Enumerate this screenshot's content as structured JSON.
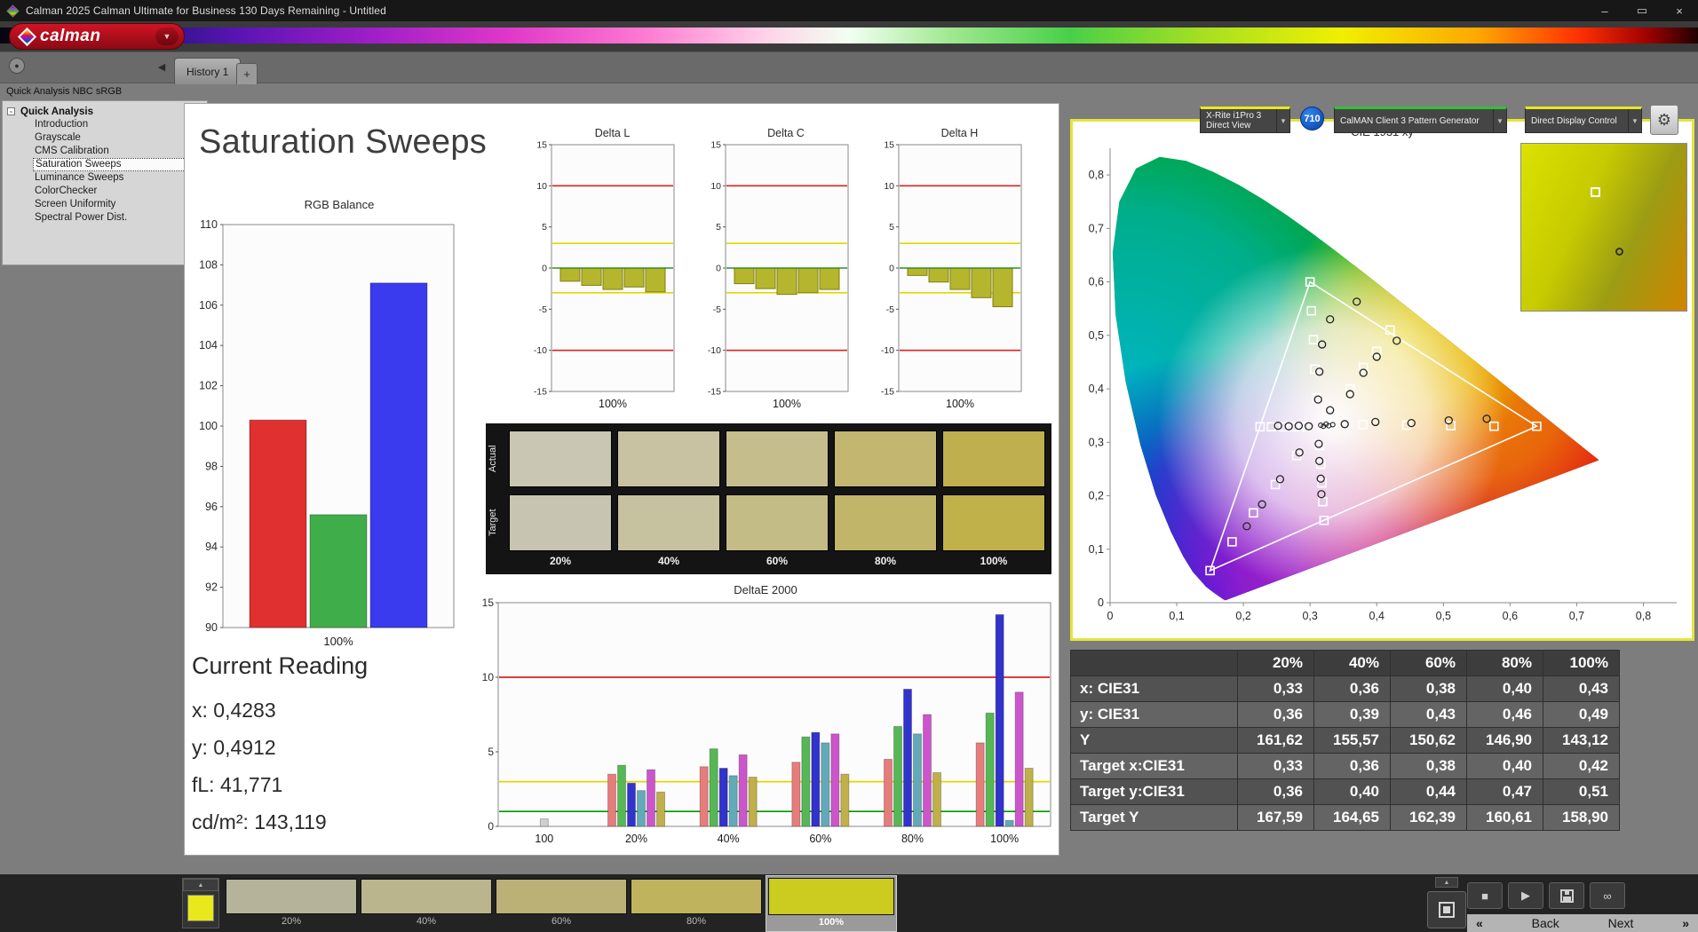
{
  "window": {
    "title": "Calman 2025 Calman Ultimate for Business 130 Days Remaining  - Untitled",
    "controls": {
      "minimize": "–",
      "maximize": "▭",
      "close": "×"
    }
  },
  "logo": {
    "text": "calman"
  },
  "tabs": {
    "history": "History 1",
    "add": "+"
  },
  "device_bar": {
    "meter": {
      "line1": "X-Rite i1Pro 3",
      "line2": "Direct View",
      "accent": "#e8e820"
    },
    "badge": "710",
    "pattern_generator": {
      "label": "CalMAN Client 3 Pattern Generator",
      "accent": "#35c035"
    },
    "display_control": {
      "label": "Direct Display Control",
      "accent": "#e8e820"
    }
  },
  "sidebar": {
    "header": "Quick Analysis NBC sRGB",
    "root": "Quick Analysis",
    "items": [
      {
        "label": "Introduction",
        "selected": false
      },
      {
        "label": "Grayscale",
        "selected": false
      },
      {
        "label": "CMS Calibration",
        "selected": false
      },
      {
        "label": "Saturation Sweeps",
        "selected": true
      },
      {
        "label": "Luminance Sweeps",
        "selected": false
      },
      {
        "label": "ColorChecker",
        "selected": false
      },
      {
        "label": "Screen Uniformity",
        "selected": false
      },
      {
        "label": "Spectral Power Dist.",
        "selected": false
      }
    ]
  },
  "page": {
    "title": "Saturation Sweeps"
  },
  "current_reading": {
    "heading": "Current Reading",
    "lines": [
      "x: 0,4283",
      "y: 0,4912",
      "fL: 41,771",
      "cd/m²: 143,119"
    ]
  },
  "charts": {
    "rgb_balance": {
      "type": "bar",
      "title": "RGB Balance",
      "ymin": 90,
      "ymax": 110,
      "ystep": 2,
      "xlabel": "100%",
      "bars": [
        {
          "name": "red",
          "color": "#e03030",
          "value": 100.3
        },
        {
          "name": "green",
          "color": "#3fae4a",
          "value": 95.6
        },
        {
          "name": "blue",
          "color": "#3a3aee",
          "value": 107.1
        }
      ]
    },
    "delta_common": {
      "ymin": -15,
      "ymax": 15,
      "ystep": 5,
      "bar_color": "#b6b62e",
      "bar_edge": "#80800e",
      "ref_red": 10,
      "ref_yellow": 3,
      "ref_green": 0
    },
    "delta_l": {
      "type": "bar",
      "title": "Delta L",
      "xlabel": "100%",
      "values": [
        -1.6,
        -2.1,
        -2.6,
        -2.3,
        -2.9
      ]
    },
    "delta_c": {
      "type": "bar",
      "title": "Delta C",
      "xlabel": "100%",
      "values": [
        -1.9,
        -2.5,
        -3.2,
        -3.0,
        -2.6
      ]
    },
    "delta_h": {
      "type": "bar",
      "title": "Delta H",
      "xlabel": "100%",
      "values": [
        -0.9,
        -1.7,
        -2.6,
        -3.6,
        -4.7
      ]
    },
    "deltae": {
      "type": "bar",
      "title": "DeltaE 2000",
      "ymin": 0,
      "ymax": 15,
      "yticks": [
        0,
        5,
        10,
        15
      ],
      "ref_lines": [
        {
          "value": 10,
          "color": "#dd2222"
        },
        {
          "value": 3,
          "color": "#e0d800"
        },
        {
          "value": 1,
          "color": "#009900"
        }
      ],
      "series_colors": [
        "#e87c7c",
        "#55b855",
        "#3232cc",
        "#62aab8",
        "#cc55cc",
        "#c0b04a"
      ],
      "single_bar_color": "#cfcfcf",
      "groups": [
        {
          "label": "100",
          "values": [
            0.5
          ]
        },
        {
          "label": "20%",
          "values": [
            3.5,
            4.1,
            2.9,
            2.4,
            3.8,
            2.3
          ]
        },
        {
          "label": "40%",
          "values": [
            4.0,
            5.2,
            3.9,
            3.4,
            4.8,
            3.3
          ]
        },
        {
          "label": "60%",
          "values": [
            4.3,
            6.0,
            6.3,
            5.6,
            6.2,
            3.5
          ]
        },
        {
          "label": "80%",
          "values": [
            4.5,
            6.7,
            9.2,
            6.2,
            7.5,
            3.6
          ]
        },
        {
          "label": "100%",
          "values": [
            5.6,
            7.6,
            14.2,
            0.4,
            9.0,
            3.9
          ]
        }
      ]
    }
  },
  "swatch_grid": {
    "row_labels": [
      "Actual",
      "Target"
    ],
    "col_labels": [
      "20%",
      "40%",
      "60%",
      "80%",
      "100%"
    ],
    "actual": [
      "#cac6b4",
      "#c8c2a2",
      "#c5bd8b",
      "#c2b671",
      "#bfaf4f"
    ],
    "target": [
      "#c7c4b2",
      "#c6c19f",
      "#c4bc86",
      "#c1b569",
      "#c0b14b"
    ]
  },
  "cie": {
    "title": "CIE 1931 xy",
    "axis_ticks": [
      "0",
      "0,1",
      "0,2",
      "0,3",
      "0,4",
      "0,5",
      "0,6",
      "0,7",
      "0,8"
    ],
    "gamut_triangle": [
      [
        0.64,
        0.33
      ],
      [
        0.3,
        0.6
      ],
      [
        0.15,
        0.06
      ]
    ],
    "targets": [
      [
        0.379,
        0.333
      ],
      [
        0.445,
        0.332
      ],
      [
        0.511,
        0.331
      ],
      [
        0.576,
        0.33
      ],
      [
        0.64,
        0.33
      ],
      [
        0.31,
        0.383
      ],
      [
        0.307,
        0.437
      ],
      [
        0.305,
        0.492
      ],
      [
        0.302,
        0.546
      ],
      [
        0.3,
        0.6
      ],
      [
        0.28,
        0.275
      ],
      [
        0.248,
        0.221
      ],
      [
        0.215,
        0.168
      ],
      [
        0.183,
        0.114
      ],
      [
        0.15,
        0.06
      ],
      [
        0.295,
        0.329
      ],
      [
        0.277,
        0.329
      ],
      [
        0.26,
        0.329
      ],
      [
        0.242,
        0.329
      ],
      [
        0.225,
        0.329
      ],
      [
        0.314,
        0.294
      ],
      [
        0.316,
        0.259
      ],
      [
        0.318,
        0.224
      ],
      [
        0.319,
        0.189
      ],
      [
        0.321,
        0.154
      ],
      [
        0.33,
        0.36
      ],
      [
        0.36,
        0.4
      ],
      [
        0.38,
        0.44
      ],
      [
        0.4,
        0.47
      ],
      [
        0.42,
        0.51
      ]
    ],
    "measurements": [
      [
        0.33,
        0.36
      ],
      [
        0.36,
        0.39
      ],
      [
        0.38,
        0.43
      ],
      [
        0.4,
        0.46
      ],
      [
        0.43,
        0.49
      ],
      [
        0.352,
        0.334
      ],
      [
        0.398,
        0.338
      ],
      [
        0.452,
        0.336
      ],
      [
        0.508,
        0.341
      ],
      [
        0.565,
        0.344
      ],
      [
        0.312,
        0.38
      ],
      [
        0.314,
        0.432
      ],
      [
        0.318,
        0.483
      ],
      [
        0.33,
        0.53
      ],
      [
        0.37,
        0.563
      ],
      [
        0.284,
        0.281
      ],
      [
        0.255,
        0.231
      ],
      [
        0.228,
        0.184
      ],
      [
        0.205,
        0.143
      ],
      [
        0.313,
        0.297
      ],
      [
        0.314,
        0.265
      ],
      [
        0.316,
        0.232
      ],
      [
        0.317,
        0.203
      ],
      [
        0.298,
        0.33
      ],
      [
        0.283,
        0.331
      ],
      [
        0.268,
        0.33
      ],
      [
        0.252,
        0.331
      ]
    ],
    "white_cluster": [
      [
        0.316,
        0.332
      ],
      [
        0.32,
        0.33
      ],
      [
        0.324,
        0.334
      ],
      [
        0.328,
        0.331
      ],
      [
        0.334,
        0.333
      ]
    ],
    "inset": {
      "square": [
        0.42,
        0.26
      ],
      "circle": [
        0.57,
        0.62
      ]
    }
  },
  "table": {
    "columns": [
      "20%",
      "40%",
      "60%",
      "80%",
      "100%"
    ],
    "rows": [
      {
        "label": "x: CIE31",
        "values": [
          "0,33",
          "0,36",
          "0,38",
          "0,40",
          "0,43"
        ]
      },
      {
        "label": "y: CIE31",
        "values": [
          "0,36",
          "0,39",
          "0,43",
          "0,46",
          "0,49"
        ]
      },
      {
        "label": "Y",
        "values": [
          "161,62",
          "155,57",
          "150,62",
          "146,90",
          "143,12"
        ]
      },
      {
        "label": "Target x:CIE31",
        "values": [
          "0,33",
          "0,36",
          "0,38",
          "0,40",
          "0,42"
        ]
      },
      {
        "label": "Target y:CIE31",
        "values": [
          "0,36",
          "0,40",
          "0,44",
          "0,47",
          "0,51"
        ]
      },
      {
        "label": "Target Y",
        "values": [
          "167,59",
          "164,65",
          "162,39",
          "160,61",
          "158,90"
        ]
      }
    ]
  },
  "bottom_bar": {
    "current_swatch_color": "#e8e81c",
    "swatches": [
      {
        "label": "20%",
        "color": "#b6b39b",
        "selected": false
      },
      {
        "label": "40%",
        "color": "#bab58d",
        "selected": false
      },
      {
        "label": "60%",
        "color": "#bbb177",
        "selected": false
      },
      {
        "label": "80%",
        "color": "#c0b35d",
        "selected": false
      },
      {
        "label": "100%",
        "color": "#cbcb20",
        "selected": true
      }
    ],
    "back_label": "Back",
    "next_label": "Next",
    "prev_chevron": "«",
    "next_chevron": "»"
  }
}
